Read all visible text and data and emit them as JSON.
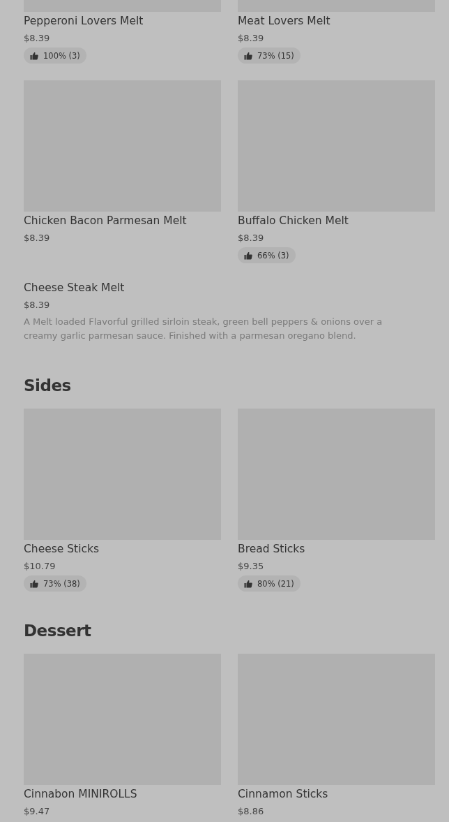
{
  "sections": [
    {
      "items": [
        {
          "kind": "card",
          "name": "Pepperoni Lovers Melt",
          "price": "$8.39",
          "rating": "100% (3)"
        },
        {
          "kind": "card",
          "name": "Meat Lovers Melt",
          "price": "$8.39",
          "rating": "73% (15)"
        },
        {
          "kind": "card",
          "name": "Chicken Bacon Parmesan Melt",
          "price": "$8.39"
        },
        {
          "kind": "card",
          "name": "Buffalo Chicken Melt",
          "price": "$8.39",
          "rating": "66% (3)"
        },
        {
          "kind": "text",
          "name": "Cheese Steak Melt",
          "price": "$8.39",
          "description": "A Melt loaded Flavorful grilled sirloin steak, green bell peppers & onions over a creamy garlic parmesan sauce. Finished with a parmesan oregano blend."
        }
      ]
    },
    {
      "title": "Sides",
      "items": [
        {
          "kind": "card",
          "name": "Cheese Sticks",
          "price": "$10.79",
          "rating": "73% (38)"
        },
        {
          "kind": "card",
          "name": "Bread Sticks",
          "price": "$9.35",
          "rating": "80% (21)"
        }
      ]
    },
    {
      "title": "Dessert",
      "items": [
        {
          "kind": "card",
          "name": "Cinnabon MINIROLLS",
          "price": "$9.47"
        },
        {
          "kind": "card",
          "name": "Cinnamon Sticks",
          "price": "$8.86"
        }
      ]
    }
  ]
}
